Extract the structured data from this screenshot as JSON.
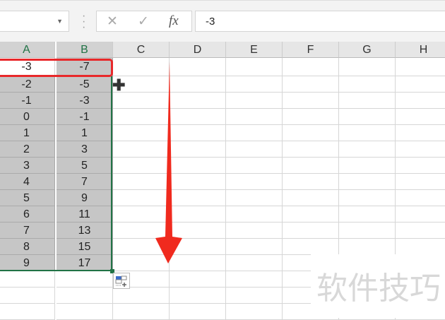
{
  "formula_bar": {
    "cancel_icon": "✕",
    "enter_icon": "✓",
    "fx_label": "fx",
    "value": "-3"
  },
  "columns": [
    "A",
    "B",
    "C",
    "D",
    "E",
    "F",
    "G",
    "H"
  ],
  "rows": [
    [
      "-3",
      "-7"
    ],
    [
      "-2",
      "-5"
    ],
    [
      "-1",
      "-3"
    ],
    [
      "0",
      "-1"
    ],
    [
      "1",
      "1"
    ],
    [
      "2",
      "3"
    ],
    [
      "3",
      "5"
    ],
    [
      "4",
      "7"
    ],
    [
      "5",
      "9"
    ],
    [
      "6",
      "11"
    ],
    [
      "7",
      "13"
    ],
    [
      "8",
      "15"
    ],
    [
      "9",
      "17"
    ]
  ],
  "watermark": "软件技巧",
  "colors": {
    "highlight": "#e8282a",
    "selection": "#217346",
    "arrow": "#f02a1e"
  }
}
